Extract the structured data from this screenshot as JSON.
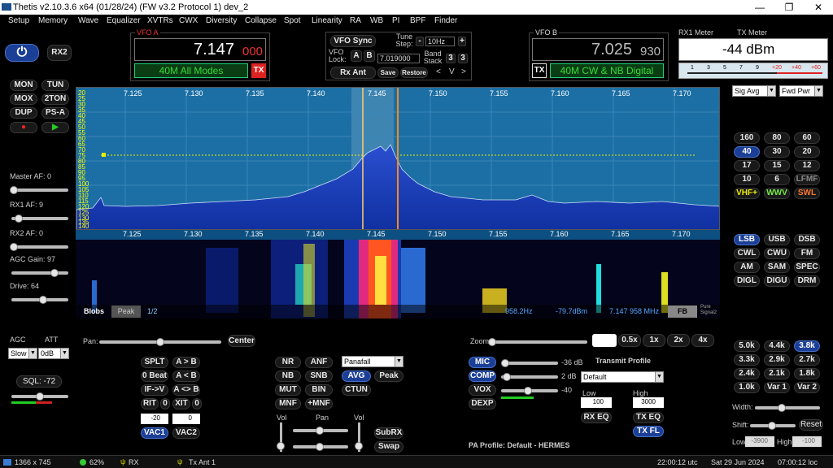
{
  "window": {
    "title": "Thetis v2.10.3.6 x64 (01/28/24) (FW v3.2 Protocol 1) dev_2",
    "minimize": "—",
    "maximize": "❐",
    "close": "✕"
  },
  "menu": [
    "Setup",
    "Memory",
    "Wave",
    "Equalizer",
    "XVTRs",
    "CWX",
    "Diversity",
    "Collapse",
    "Spot",
    "Linearity",
    "RA",
    "WB",
    "PI",
    "BPF",
    "Finder"
  ],
  "left": {
    "power": "⏻",
    "rx2": "RX2",
    "mon": "MON",
    "tun": "TUN",
    "mox": "MOX",
    "ton2": "2TON",
    "dup": "DUP",
    "psa": "PS-A",
    "rec": "●",
    "play": "▶",
    "master_af": "Master AF:  0",
    "rx1_af": "RX1 AF:  9",
    "rx2_af": "RX2 AF:  0",
    "agc_gain": "AGC Gain:  97",
    "drive": "Drive:  64",
    "agc": "AGC",
    "att": "ATT",
    "agc_val": "Slow",
    "att_val": "0dB",
    "sql": "SQL: -72"
  },
  "vfoa": {
    "label": "VFO A",
    "freq": "7.147",
    "freq_small": "000",
    "band": "40M All Modes",
    "tx": "TX"
  },
  "vfoctl": {
    "vfo_sync": "VFO Sync",
    "tune_step": "Tune Step:",
    "minus": "-",
    "step": "10Hz",
    "plus": "+",
    "vfo_lock": "VFO Lock:",
    "a": "A",
    "b": "B",
    "lock_freq": "7.019000",
    "band_stack": "Band Stack",
    "bs1": "3",
    "bs2": "3",
    "rx_ant": "Rx Ant",
    "save": "Save",
    "restore": "Restore",
    "lt": "<",
    "v": "V",
    ">": ">"
  },
  "vfob": {
    "label": "VFO B",
    "freq": "7.025",
    "freq_small": "930",
    "band": "40M CW & NB Digital",
    "tx": "TX"
  },
  "meters": {
    "rx1": "RX1 Meter",
    "tx": "TX Meter",
    "dbm": "-44 dBm",
    "scale": [
      "1",
      "3",
      "5",
      "7",
      "9",
      "+20",
      "+40",
      "+60"
    ],
    "sig": "Sig Avg",
    "fwd": "Fwd Pwr"
  },
  "spectrum": {
    "ticks": [
      "7.125",
      "7.130",
      "7.135",
      "7.140",
      "7.145",
      "7.150",
      "7.155",
      "7.160",
      "7.165",
      "7.170"
    ],
    "db": [
      "20",
      "25",
      "30",
      "35",
      "40",
      "45",
      "50",
      "55",
      "60",
      "65",
      "70",
      "75",
      "80",
      "85",
      "90",
      "95",
      "100",
      "105",
      "110",
      "115",
      "120",
      "125",
      "130",
      "135",
      "140"
    ],
    "blobs": "Blobs",
    "peak": "Peak",
    "half": "1/2",
    "hz": "958.2Hz",
    "dbm": "-79.7dBm",
    "mhz": "7.147 958 MHz",
    "fb": "FB",
    "pure": "Pure Signal2"
  },
  "bands": [
    "160",
    "80",
    "60",
    "40",
    "30",
    "20",
    "17",
    "15",
    "12",
    "10",
    "6",
    "LFMF",
    "VHF+",
    "WWV",
    "SWL"
  ],
  "modes": [
    "LSB",
    "USB",
    "DSB",
    "CWL",
    "CWU",
    "FM",
    "AM",
    "SAM",
    "SPEC",
    "DIGL",
    "DIGU",
    "DRM"
  ],
  "filters": [
    "5.0k",
    "4.4k",
    "3.8k",
    "3.3k",
    "2.9k",
    "2.7k",
    "2.4k",
    "2.1k",
    "1.8k",
    "1.0k",
    "Var 1",
    "Var 2"
  ],
  "filterctl": {
    "width": "Width:",
    "shift": "Shift:",
    "reset": "Reset",
    "low": "Low",
    "low_val": "-3900",
    "high": "High",
    "high_val": "-100"
  },
  "pan": {
    "pan": "Pan:",
    "center": "Center",
    "zoom": "Zoom:",
    "z1": "0.5x",
    "z2": "1x",
    "z3": "2x",
    "z4": "4x"
  },
  "vfoops": {
    "splt": "SPLT",
    "ab": "A > B",
    "beat": "0 Beat",
    "ba": "A < B",
    "ifv": "IF->V",
    "aswap": "A <> B",
    "rit": "RIT",
    "rit0": "0",
    "xit": "XIT",
    "xit0": "0",
    "rit_val": "-20",
    "xit_val": "0",
    "vac1": "VAC1",
    "vac2": "VAC2"
  },
  "dsp": {
    "nr": "NR",
    "anf": "ANF",
    "nb": "NB",
    "snb": "SNB",
    "mut": "MUT",
    "bin": "BIN",
    "mnf": "MNF",
    "pmnf": "+MNF",
    "display": "Panafall",
    "avg": "AVG",
    "peak": "Peak",
    "ctun": "CTUN",
    "vol1": "Vol",
    "pan": "Pan",
    "vol2": "Vol",
    "subrx": "SubRX",
    "swap": "Swap"
  },
  "tx": {
    "mic": "MIC",
    "mic_val": "-36 dB",
    "comp": "COMP",
    "comp_val": "2 dB",
    "vox": "VOX",
    "vox_val": "-40",
    "dexp": "DEXP",
    "profile_lbl": "Transmit Profile",
    "profile": "Default",
    "low": "Low",
    "high": "High",
    "low_val": "100",
    "high_val": "3000",
    "rxeq": "RX EQ",
    "txeq": "TX EQ",
    "txfl": "TX FL",
    "pa": "PA Profile: Default - HERMES"
  },
  "status": {
    "res": "1366 x 745",
    "cpu": "62%",
    "rx": "RX",
    "txant": "Tx Ant 1",
    "utc": "22:00:12 utc",
    "date": "Sat 29 Jun 2024",
    "loc": "07:00:12 loc"
  }
}
